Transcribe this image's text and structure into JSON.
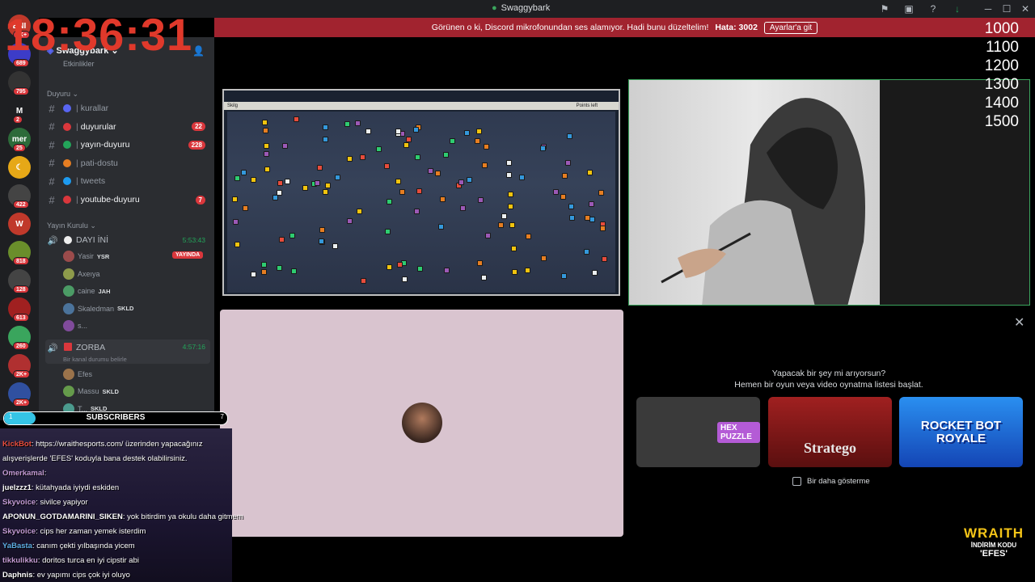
{
  "window": {
    "title": "Swaggybark",
    "controls": {
      "minimize": "─",
      "maximize": "☐",
      "close": "✕"
    }
  },
  "clock": "18:36:31",
  "banner": {
    "message": "Görünen o ki, Discord mikrofonundan ses alamıyor. Hadi bunu düzeltelim!",
    "error": "Hata: 3002",
    "button": "Ayarlar'a git"
  },
  "guilds": [
    {
      "label": "ENI",
      "badge": "1K+",
      "color": "#c0392b"
    },
    {
      "label": "",
      "badge": "689",
      "color": "#3c3cc8"
    },
    {
      "label": "",
      "badge": "795",
      "color": "#333"
    },
    {
      "label": "M",
      "badge": "2",
      "color": "#1e1f22"
    },
    {
      "label": "mer",
      "badge": "25",
      "color": "#2d6b3a"
    },
    {
      "label": "☾",
      "badge": "",
      "color": "#e6a817"
    },
    {
      "label": "",
      "badge": "422",
      "color": "#444"
    },
    {
      "label": "W",
      "badge": "",
      "color": "#c0392b"
    },
    {
      "label": "",
      "badge": "818",
      "color": "#6a8e2b"
    },
    {
      "label": "",
      "badge": "128",
      "color": "#444"
    },
    {
      "label": "",
      "badge": "613",
      "color": "#a02020"
    },
    {
      "label": "",
      "badge": "260",
      "color": "#3aa55d"
    },
    {
      "label": "",
      "badge": "2K+",
      "color": "#b03030"
    },
    {
      "label": "",
      "badge": "2K+",
      "color": "#3050a0"
    }
  ],
  "server": {
    "name": "Swaggybark",
    "events_label": "Etkinlikler",
    "categories": [
      {
        "name": "Duyuru",
        "channels": [
          {
            "name": "kurallar",
            "badge": "",
            "unread": false,
            "color": "#5865f2"
          },
          {
            "name": "duyurular",
            "badge": "22",
            "unread": true,
            "color": "#da373c"
          },
          {
            "name": "yayın-duyuru",
            "badge": "228",
            "unread": true,
            "color": "#23a55a"
          },
          {
            "name": "pati-dostu",
            "badge": "",
            "unread": false,
            "color": "#e67e22"
          },
          {
            "name": "tweets",
            "badge": "",
            "unread": false,
            "color": "#1d9bf0"
          },
          {
            "name": "youtube-duyuru",
            "badge": "7",
            "unread": true,
            "color": "#da373c"
          }
        ]
      }
    ],
    "voice_category": "Yayın Kurulu",
    "voice_channels": [
      {
        "name": "DAYI İNİ",
        "time": "5:53:43",
        "users": [
          {
            "name": "Yasir",
            "tag": "YSR",
            "live": "YAYINDA"
          },
          {
            "name": "Axeıya",
            "tag": "",
            "live": ""
          },
          {
            "name": "caine",
            "tag": "JAH",
            "live": ""
          },
          {
            "name": "Skaledman",
            "tag": "SKLD",
            "live": ""
          },
          {
            "name": "s...",
            "tag": "",
            "live": ""
          }
        ]
      },
      {
        "name": "ZORBA",
        "time": "4:57:16",
        "status": "Bir kanal durumu belirle",
        "users": [
          {
            "name": "Efes",
            "tag": "",
            "live": ""
          },
          {
            "name": "Massu",
            "tag": "SKLD",
            "live": ""
          },
          {
            "name": "T...",
            "tag": "SKLD",
            "live": ""
          }
        ]
      }
    ]
  },
  "subscribers": {
    "label": "SUBSCRIBERS",
    "current": "1",
    "goal": "7",
    "progress": 0.14
  },
  "chat": [
    {
      "user": "KickBot",
      "color": "#e74c3c",
      "text": ": https://wraithesports.com/ üzerinden yapacağınız"
    },
    {
      "user": "",
      "color": "#fff",
      "text": "alışverişlerde 'EFES' koduyla bana destek olabilirsiniz."
    },
    {
      "user": "Omerkamal",
      "color": "#c39bd3",
      "text": ":"
    },
    {
      "user": "juelzzz1",
      "color": "#fff",
      "text": ": kütahyada iyiydi eskiden"
    },
    {
      "user": "Skyvoice",
      "color": "#c39bd3",
      "text": ": sivilce yapiyor"
    },
    {
      "user": "APONUN_GOTDAMARINI_SIKEN",
      "color": "#fff",
      "text": ": yok bitirdim ya okulu daha gitmem"
    },
    {
      "user": "Skyvoice",
      "color": "#c39bd3",
      "text": ": cips her zaman yemek isterdim"
    },
    {
      "user": "YaBasta",
      "color": "#5dade2",
      "text": ": canım çekti yılbaşında yicem"
    },
    {
      "user": "tikkulikku",
      "color": "#c39bd3",
      "text": ": doritos turca en iyi cipstir abi"
    },
    {
      "user": "Daphnis",
      "color": "#fff",
      "text": ": ev yapımı cips çok iyi oluyo"
    }
  ],
  "game_window": {
    "title": "Skilg",
    "hud": "Points left"
  },
  "activity": {
    "title_line1": "Yapacak bir şey mi arıyorsun?",
    "title_line2": "Hemen bir oyun veya video oynatma listesi başlat.",
    "games": [
      {
        "name": "HEX PUZZLE",
        "bg": "#3a3a3a"
      },
      {
        "name": "Stratego",
        "bg": "#7a1a1a"
      },
      {
        "name": "ROCKET BOT ROYALE",
        "bg": "#1b5fd6"
      }
    ],
    "checkbox_label": "Bir daha gösterme"
  },
  "ladder": [
    "1000",
    "1100",
    "1200",
    "1300",
    "1400",
    "1500"
  ],
  "sponsor": {
    "brand": "WRAITH",
    "line1": "İNDİRİM KODU",
    "line2": "'EFES'"
  }
}
